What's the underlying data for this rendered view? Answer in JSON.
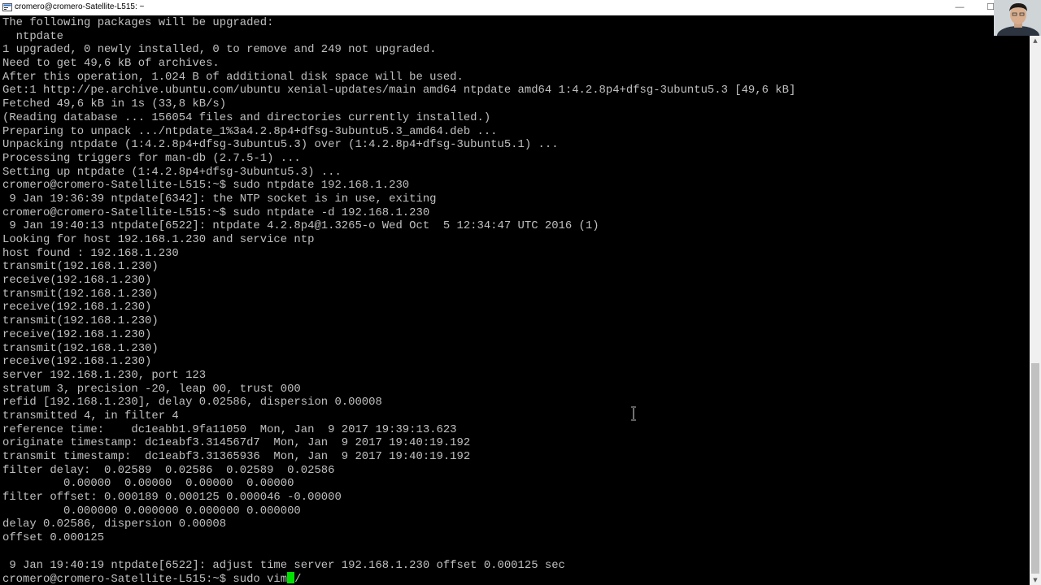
{
  "window": {
    "title": "cromero@cromero-Satellite-L515: ~",
    "minimize_label": "—",
    "maximize_label": "☐"
  },
  "terminal": {
    "lines": [
      "The following packages will be upgraded:",
      "  ntpdate",
      "1 upgraded, 0 newly installed, 0 to remove and 249 not upgraded.",
      "Need to get 49,6 kB of archives.",
      "After this operation, 1.024 B of additional disk space will be used.",
      "Get:1 http://pe.archive.ubuntu.com/ubuntu xenial-updates/main amd64 ntpdate amd64 1:4.2.8p4+dfsg-3ubuntu5.3 [49,6 kB]",
      "Fetched 49,6 kB in 1s (33,8 kB/s)",
      "(Reading database ... 156054 files and directories currently installed.)",
      "Preparing to unpack .../ntpdate_1%3a4.2.8p4+dfsg-3ubuntu5.3_amd64.deb ...",
      "Unpacking ntpdate (1:4.2.8p4+dfsg-3ubuntu5.3) over (1:4.2.8p4+dfsg-3ubuntu5.1) ...",
      "Processing triggers for man-db (2.7.5-1) ...",
      "Setting up ntpdate (1:4.2.8p4+dfsg-3ubuntu5.3) ...",
      "cromero@cromero-Satellite-L515:~$ sudo ntpdate 192.168.1.230",
      " 9 Jan 19:36:39 ntpdate[6342]: the NTP socket is in use, exiting",
      "cromero@cromero-Satellite-L515:~$ sudo ntpdate -d 192.168.1.230",
      " 9 Jan 19:40:13 ntpdate[6522]: ntpdate 4.2.8p4@1.3265-o Wed Oct  5 12:34:47 UTC 2016 (1)",
      "Looking for host 192.168.1.230 and service ntp",
      "host found : 192.168.1.230",
      "transmit(192.168.1.230)",
      "receive(192.168.1.230)",
      "transmit(192.168.1.230)",
      "receive(192.168.1.230)",
      "transmit(192.168.1.230)",
      "receive(192.168.1.230)",
      "transmit(192.168.1.230)",
      "receive(192.168.1.230)",
      "server 192.168.1.230, port 123",
      "stratum 3, precision -20, leap 00, trust 000",
      "refid [192.168.1.230], delay 0.02586, dispersion 0.00008",
      "transmitted 4, in filter 4",
      "reference time:    dc1eabb1.9fa11050  Mon, Jan  9 2017 19:39:13.623",
      "originate timestamp: dc1eabf3.314567d7  Mon, Jan  9 2017 19:40:19.192",
      "transmit timestamp:  dc1eabf3.31365936  Mon, Jan  9 2017 19:40:19.192",
      "filter delay:  0.02589  0.02586  0.02589  0.02586",
      "         0.00000  0.00000  0.00000  0.00000",
      "filter offset: 0.000189 0.000125 0.000046 -0.00000",
      "         0.000000 0.000000 0.000000 0.000000",
      "delay 0.02586, dispersion 0.00008",
      "offset 0.000125",
      "",
      " 9 Jan 19:40:19 ntpdate[6522]: adjust time server 192.168.1.230 offset 0.000125 sec"
    ],
    "prompt": "cromero@cromero-Satellite-L515:~$ ",
    "typed_command": "sudo vim",
    "after_cursor": "/",
    "cursor_color": "#00e000",
    "text_color": "#c0c0c0",
    "background_color": "#000000"
  }
}
